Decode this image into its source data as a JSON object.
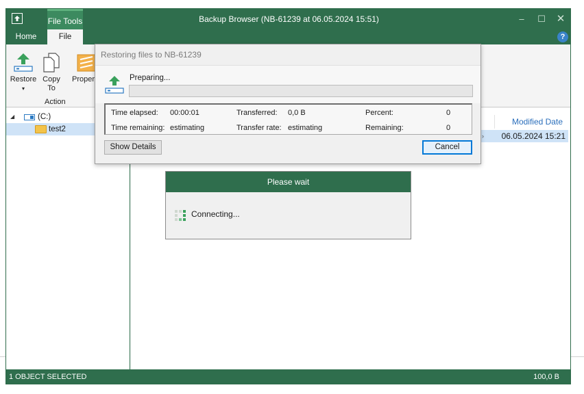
{
  "window": {
    "title": "Backup Browser (NB-61239 at 06.05.2024 15:51)",
    "context_tab": "File Tools",
    "controls": {
      "minimize": "–",
      "maximize": "☐",
      "close": "✕"
    }
  },
  "ribbon": {
    "tabs": {
      "home": "Home",
      "file": "File"
    },
    "help": "?",
    "buttons": {
      "restore": "Restore",
      "restore_arrow": "▾",
      "copy_line1": "Copy",
      "copy_line2": "To",
      "properties": "Propertie"
    },
    "group_label": "Action"
  },
  "tree": {
    "drive_toggle": "◢",
    "drive_label": "(C:)",
    "folder_label": "test2"
  },
  "content": {
    "column_modified": "Modified Date",
    "row_modified": "06.05.2024 15:21",
    "row_marker": "›"
  },
  "statusbar": {
    "left": "1 OBJECT SELECTED",
    "right": "100,0 B"
  },
  "restore_dialog": {
    "title": "Restoring files to NB-61239",
    "status": "Preparing...",
    "progress_fraction": 0,
    "stats": {
      "time_elapsed_label": "Time elapsed:",
      "time_elapsed": "00:00:01",
      "time_remaining_label": "Time remaining:",
      "time_remaining": "estimating",
      "transferred_label": "Transferred:",
      "transferred": "0,0 B",
      "transfer_rate_label": "Transfer rate:",
      "transfer_rate": "estimating",
      "percent_label": "Percent:",
      "percent": "0",
      "remaining_label": "Remaining:",
      "remaining": "0"
    },
    "show_details": "Show Details",
    "cancel": "Cancel"
  },
  "wait_dialog": {
    "title": "Please wait",
    "message": "Connecting..."
  },
  "colors": {
    "brand_green": "#2f6e4d",
    "accent_blue": "#0078d7",
    "selection": "#cfe3f7"
  }
}
